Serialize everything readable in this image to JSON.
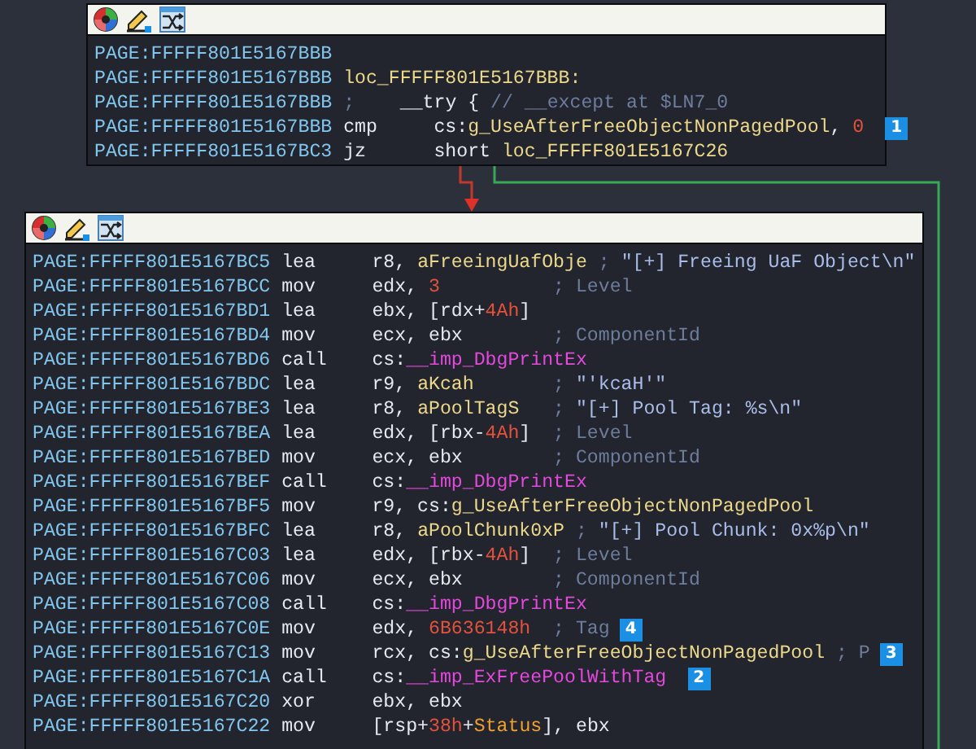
{
  "blocks": [
    {
      "lines": [
        {
          "address": "PAGE:FFFFF801E5167BBB"
        },
        {
          "address": "PAGE:FFFFF801E5167BBB",
          "label": "loc_FFFFF801E5167BBB:"
        },
        {
          "address": "PAGE:FFFFF801E5167BBB",
          "comment": [
            {
              "kind": "cmt",
              "text": ";    "
            },
            {
              "kind": "plain",
              "text": "__try { "
            },
            {
              "kind": "cmt",
              "text": "// __except at $LN7_0"
            }
          ]
        },
        {
          "address": "PAGE:FFFFF801E5167BBB",
          "mnemonic": "cmp",
          "operands": [
            {
              "kind": "plain",
              "text": "cs:"
            },
            {
              "kind": "name",
              "text": "g_UseAfterFreeObjectNonPagedPool"
            },
            {
              "kind": "plain",
              "text": ", "
            },
            {
              "kind": "num",
              "text": "0"
            }
          ],
          "badge": "1"
        },
        {
          "address": "PAGE:FFFFF801E5167BC3",
          "mnemonic": "jz",
          "operands": [
            {
              "kind": "plain",
              "text": "short "
            },
            {
              "kind": "name",
              "text": "loc_FFFFF801E5167C26"
            }
          ]
        }
      ]
    },
    {
      "lines": [
        {
          "address": "PAGE:FFFFF801E5167BC5",
          "mnemonic": "lea",
          "operands": [
            {
              "kind": "plain",
              "text": "r8, "
            },
            {
              "kind": "name",
              "text": "aFreeingUafObje"
            }
          ],
          "comment": [
            {
              "kind": "cmt",
              "text": "; "
            },
            {
              "kind": "str",
              "text": "\"[+] Freeing UaF Object\\n\""
            }
          ]
        },
        {
          "address": "PAGE:FFFFF801E5167BCC",
          "mnemonic": "mov",
          "operands": [
            {
              "kind": "plain",
              "text": "edx, "
            },
            {
              "kind": "num",
              "text": "3"
            }
          ],
          "comment": [
            {
              "kind": "cmt",
              "text": "; Level"
            }
          ]
        },
        {
          "address": "PAGE:FFFFF801E5167BD1",
          "mnemonic": "lea",
          "operands": [
            {
              "kind": "plain",
              "text": "ebx, [rdx+"
            },
            {
              "kind": "num",
              "text": "4Ah"
            },
            {
              "kind": "plain",
              "text": "]"
            }
          ]
        },
        {
          "address": "PAGE:FFFFF801E5167BD4",
          "mnemonic": "mov",
          "operands": [
            {
              "kind": "plain",
              "text": "ecx, ebx"
            }
          ],
          "comment": [
            {
              "kind": "cmt",
              "text": "; ComponentId"
            }
          ]
        },
        {
          "address": "PAGE:FFFFF801E5167BD6",
          "mnemonic": "call",
          "operands": [
            {
              "kind": "plain",
              "text": "cs:"
            },
            {
              "kind": "imp",
              "text": "__imp_DbgPrintEx"
            }
          ]
        },
        {
          "address": "PAGE:FFFFF801E5167BDC",
          "mnemonic": "lea",
          "operands": [
            {
              "kind": "plain",
              "text": "r9, "
            },
            {
              "kind": "name",
              "text": "aKcah"
            }
          ],
          "comment": [
            {
              "kind": "cmt",
              "text": "; "
            },
            {
              "kind": "str",
              "text": "\"'kcaH'\""
            }
          ]
        },
        {
          "address": "PAGE:FFFFF801E5167BE3",
          "mnemonic": "lea",
          "operands": [
            {
              "kind": "plain",
              "text": "r8, "
            },
            {
              "kind": "name",
              "text": "aPoolTagS"
            }
          ],
          "comment": [
            {
              "kind": "cmt",
              "text": "; "
            },
            {
              "kind": "str",
              "text": "\"[+] Pool Tag: %s\\n\""
            }
          ]
        },
        {
          "address": "PAGE:FFFFF801E5167BEA",
          "mnemonic": "lea",
          "operands": [
            {
              "kind": "plain",
              "text": "edx, [rbx-"
            },
            {
              "kind": "num",
              "text": "4Ah"
            },
            {
              "kind": "plain",
              "text": "]"
            }
          ],
          "comment": [
            {
              "kind": "cmt",
              "text": "; Level"
            }
          ]
        },
        {
          "address": "PAGE:FFFFF801E5167BED",
          "mnemonic": "mov",
          "operands": [
            {
              "kind": "plain",
              "text": "ecx, ebx"
            }
          ],
          "comment": [
            {
              "kind": "cmt",
              "text": "; ComponentId"
            }
          ]
        },
        {
          "address": "PAGE:FFFFF801E5167BEF",
          "mnemonic": "call",
          "operands": [
            {
              "kind": "plain",
              "text": "cs:"
            },
            {
              "kind": "imp",
              "text": "__imp_DbgPrintEx"
            }
          ]
        },
        {
          "address": "PAGE:FFFFF801E5167BF5",
          "mnemonic": "mov",
          "operands": [
            {
              "kind": "plain",
              "text": "r9, cs:"
            },
            {
              "kind": "name",
              "text": "g_UseAfterFreeObjectNonPagedPool"
            }
          ]
        },
        {
          "address": "PAGE:FFFFF801E5167BFC",
          "mnemonic": "lea",
          "operands": [
            {
              "kind": "plain",
              "text": "r8, "
            },
            {
              "kind": "name",
              "text": "aPoolChunk0xP"
            }
          ],
          "comment": [
            {
              "kind": "cmt",
              "text": "; "
            },
            {
              "kind": "str",
              "text": "\"[+] Pool Chunk: 0x%p\\n\""
            }
          ]
        },
        {
          "address": "PAGE:FFFFF801E5167C03",
          "mnemonic": "lea",
          "operands": [
            {
              "kind": "plain",
              "text": "edx, [rbx-"
            },
            {
              "kind": "num",
              "text": "4Ah"
            },
            {
              "kind": "plain",
              "text": "]"
            }
          ],
          "comment": [
            {
              "kind": "cmt",
              "text": "; Level"
            }
          ]
        },
        {
          "address": "PAGE:FFFFF801E5167C06",
          "mnemonic": "mov",
          "operands": [
            {
              "kind": "plain",
              "text": "ecx, ebx"
            }
          ],
          "comment": [
            {
              "kind": "cmt",
              "text": "; ComponentId"
            }
          ]
        },
        {
          "address": "PAGE:FFFFF801E5167C08",
          "mnemonic": "call",
          "operands": [
            {
              "kind": "plain",
              "text": "cs:"
            },
            {
              "kind": "imp",
              "text": "__imp_DbgPrintEx"
            }
          ]
        },
        {
          "address": "PAGE:FFFFF801E5167C0E",
          "mnemonic": "mov",
          "operands": [
            {
              "kind": "plain",
              "text": "edx, "
            },
            {
              "kind": "num",
              "text": "6B636148h"
            }
          ],
          "comment": [
            {
              "kind": "cmt",
              "text": "; Tag"
            }
          ],
          "badge": "4"
        },
        {
          "address": "PAGE:FFFFF801E5167C13",
          "mnemonic": "mov",
          "operands": [
            {
              "kind": "plain",
              "text": "rcx, cs:"
            },
            {
              "kind": "name",
              "text": "g_UseAfterFreeObjectNonPagedPool"
            }
          ],
          "comment": [
            {
              "kind": "cmt",
              "text": "; P"
            }
          ],
          "badge": "3"
        },
        {
          "address": "PAGE:FFFFF801E5167C1A",
          "mnemonic": "call",
          "operands": [
            {
              "kind": "plain",
              "text": "cs:"
            },
            {
              "kind": "imp",
              "text": "__imp_ExFreePoolWithTag"
            }
          ],
          "badge": "2"
        },
        {
          "address": "PAGE:FFFFF801E5167C20",
          "mnemonic": "xor",
          "operands": [
            {
              "kind": "plain",
              "text": "ebx, ebx"
            }
          ]
        },
        {
          "address": "PAGE:FFFFF801E5167C22",
          "mnemonic": "mov",
          "operands": [
            {
              "kind": "plain",
              "text": "[rsp+"
            },
            {
              "kind": "num",
              "text": "38h"
            },
            {
              "kind": "plain",
              "text": "+"
            },
            {
              "kind": "var",
              "text": "Status"
            },
            {
              "kind": "plain",
              "text": "], ebx"
            }
          ]
        }
      ]
    }
  ]
}
